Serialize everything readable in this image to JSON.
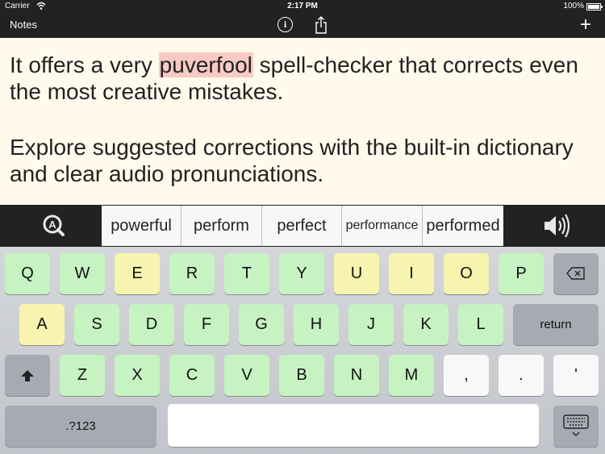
{
  "status_bar": {
    "carrier": "Carrier",
    "time": "2:17 PM",
    "battery": "100%"
  },
  "nav_bar": {
    "notes_label": "Notes",
    "info_label": "i",
    "add_label": "+"
  },
  "note": {
    "p1_before": "It offers a very ",
    "p1_highlight": "puverfool",
    "p1_after": " spell-checker that corrects even the most creative mistakes.",
    "p2": "Explore suggested corrections with the built-in dictionary and clear audio pronunciations."
  },
  "suggestions": [
    "powerful",
    "perform",
    "perfect",
    "performance",
    "performed"
  ],
  "keyboard": {
    "row1": [
      "Q",
      "W",
      "E",
      "R",
      "T",
      "Y",
      "U",
      "I",
      "O",
      "P"
    ],
    "row2": [
      "A",
      "S",
      "D",
      "F",
      "G",
      "H",
      "J",
      "K",
      "L"
    ],
    "row3": [
      "Z",
      "X",
      "C",
      "V",
      "B",
      "N",
      "M",
      ",",
      ".",
      "'"
    ],
    "return_label": "return",
    "numbers_label": ".?123"
  },
  "colors": {
    "bar": "#222222",
    "note_bg": "#fffaec",
    "highlight": "#f9c9c4",
    "key_green": "#c7f2c2",
    "key_yellow": "#f6f4ae"
  }
}
